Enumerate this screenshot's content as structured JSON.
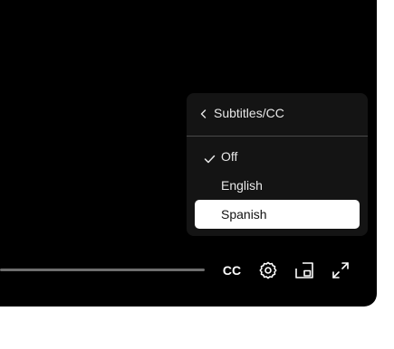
{
  "subtitles_menu": {
    "title": "Subtitles/CC",
    "back_icon": "chevron-left-icon",
    "options": [
      {
        "label": "Off",
        "checked": true,
        "highlighted": false
      },
      {
        "label": "English",
        "checked": false,
        "highlighted": false
      },
      {
        "label": "Spanish",
        "checked": false,
        "highlighted": true
      }
    ]
  },
  "controls": {
    "cc_label": "CC",
    "settings_icon": "gear-icon",
    "pip_icon": "picture-in-picture-icon",
    "fullscreen_icon": "fullscreen-icon"
  },
  "colors": {
    "player_bg": "#000000",
    "menu_bg": "#141414",
    "highlight_bg": "#ffffff",
    "text": "#e8e8e8"
  }
}
